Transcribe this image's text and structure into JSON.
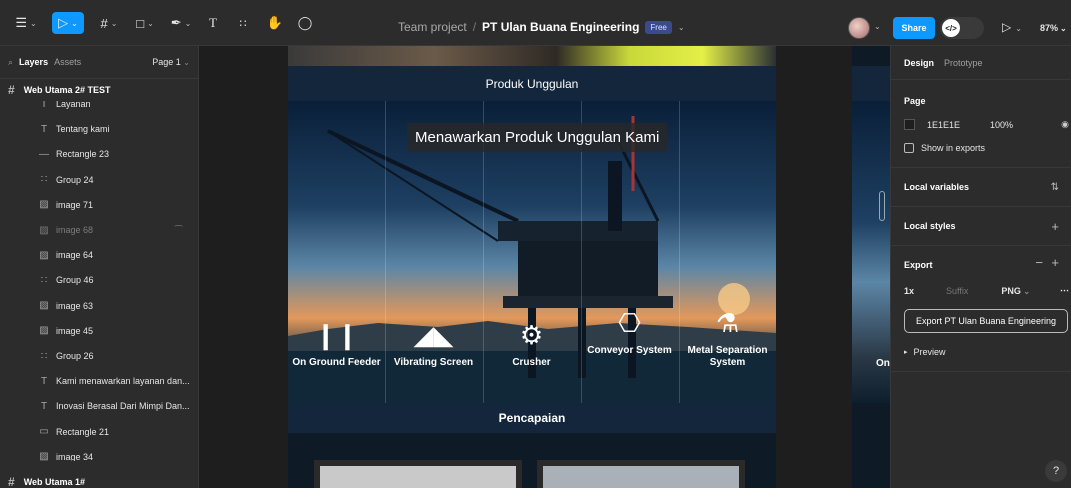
{
  "toolbar": {
    "main_menu_icon": "figma-logo-icon",
    "move_tool_icon": "cursor-arrow-icon",
    "frame_tool_icon": "hash-frame-icon",
    "shape_tool_icon": "square-icon",
    "pen_tool_icon": "pen-icon",
    "text_tool_glyph": "T",
    "resources_icon": "resources-icon",
    "hand_tool_icon": "hand-icon",
    "comment_icon": "comment-bubble-icon",
    "team": "Team project",
    "separator": "/",
    "file_name": "PT Ulan Buana Engineering",
    "plan_badge": "Free",
    "share_label": "Share",
    "zoom": "87%",
    "accent_color": "#0d99ff"
  },
  "left_panel": {
    "tab_layers": "Layers",
    "tab_assets": "Assets",
    "page_selector": "Page 1",
    "frame_top": "Web Utama 2# TEST",
    "frame_bottom": "Web Utama 1#",
    "layers": [
      {
        "name": "Layanan",
        "icon": "text-icon"
      },
      {
        "name": "Tentang kami",
        "icon": "text-icon"
      },
      {
        "name": "Rectangle 23",
        "icon": "line-icon"
      },
      {
        "name": "Group 24",
        "icon": "group-icon"
      },
      {
        "name": "image 71",
        "icon": "image-icon"
      },
      {
        "name": "image 68",
        "icon": "image-icon"
      },
      {
        "name": "image 64",
        "icon": "image-icon"
      },
      {
        "name": "Group 46",
        "icon": "group-icon"
      },
      {
        "name": "image 63",
        "icon": "image-icon"
      },
      {
        "name": "image 45",
        "icon": "image-icon"
      },
      {
        "name": "Group 26",
        "icon": "group-icon"
      },
      {
        "name": "Kami menawarkan layanan dan...",
        "icon": "text-icon"
      },
      {
        "name": "Inovasi Berasal Dari Mimpi Dan...",
        "icon": "text-icon"
      },
      {
        "name": "Rectangle 21",
        "icon": "rectangle-icon"
      },
      {
        "name": "image 34",
        "icon": "image-icon"
      }
    ]
  },
  "canvas": {
    "section_products": "Produk Unggulan",
    "hero_title": "Menawarkan Produk Unggulan Kami",
    "products": [
      {
        "label": "On Ground Feeder",
        "icon": "feeder-icon"
      },
      {
        "label": "Vibrating Screen",
        "icon": "vibrating-screen-icon"
      },
      {
        "label": "Crusher",
        "icon": "crusher-icon"
      },
      {
        "label": "Conveyor System",
        "icon": "conveyor-icon"
      },
      {
        "label": "Metal Separation System",
        "icon": "metal-separation-icon"
      }
    ],
    "section_achievements": "Pencapaian",
    "side_frame_text": "On"
  },
  "right_panel": {
    "tab_design": "Design",
    "tab_prototype": "Prototype",
    "page_heading": "Page",
    "page_color": "1E1E1E",
    "page_opacity": "100%",
    "show_in_exports": "Show in exports",
    "local_variables": "Local variables",
    "local_styles": "Local styles",
    "export_heading": "Export",
    "export_scale": "1x",
    "export_suffix_placeholder": "Suffix",
    "export_format": "PNG",
    "export_button": "Export PT Ulan Buana Engineering",
    "preview": "Preview"
  },
  "help_label": "?"
}
